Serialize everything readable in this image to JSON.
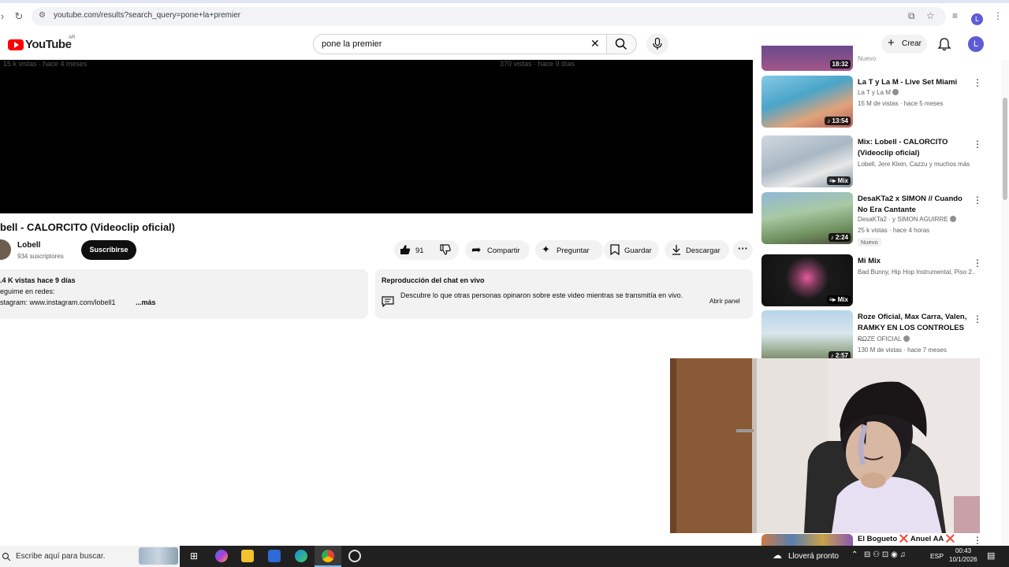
{
  "browser": {
    "url": "youtube.com/results?search_query=pone+la+premier"
  },
  "header": {
    "logo_text": "YouTube",
    "country_code": "AR",
    "search_value": "pone la premier",
    "create_label": "Crear",
    "avatar_letter": "L"
  },
  "player": {
    "ghost_left": "15 k vistas · hace 4 meses",
    "ghost_right": "370 vistas · hace 9 días"
  },
  "video": {
    "title": "bell - CALORCITO (Videoclip oficial)",
    "channel": "Lobell",
    "subscribers": "934 suscriptores",
    "subscribe_label": "Suscribirse",
    "likes": "91",
    "share_label": "Compartir",
    "ask_label": "Preguntar",
    "save_label": "Guardar",
    "download_label": "Descargar"
  },
  "description": {
    "stats": ".4 K vistas  hace 9 días",
    "line2": "eguime en redes:",
    "line3": "stagram: www.instagram.com/lobell1",
    "more": "...más"
  },
  "chat": {
    "title": "Reproducción del chat en vivo",
    "body": "Descubre lo que otras personas opinaron sobre este video mientras se transmitía en vivo.",
    "open_label": "Abrir panel"
  },
  "sidebar": {
    "partial_top": {
      "duration": "18:32",
      "tag": "Nuevo"
    },
    "items": [
      {
        "title": "La T y La M - Live Set Miami",
        "channel": "La T y La M",
        "meta": "15 M de vistas · hace 5 meses",
        "badge": "13:54",
        "new": ""
      },
      {
        "title": "Mix: Lobell - CALORCITO (Videoclip oficial)",
        "channel": "Lobell, Jere Klein, Cazzu y muchos más",
        "meta": "",
        "badge": "Mix",
        "new": ""
      },
      {
        "title": "DesaKTa2 x SIMON // Cuando No Era Cantante",
        "channel": "DesaKTa2 · y SIMON AGUIRRE",
        "meta": "25 k vistas · hace 4 horas",
        "badge": "2:24",
        "new": "Nuevo"
      },
      {
        "title": "Mi Mix",
        "channel": "Bad Bunny, Hip Hop Instrumental, Piso 2...",
        "meta": "",
        "badge": "Mix",
        "new": ""
      },
      {
        "title": "Roze Oficial, Max Carra, Valen, RAMKY EN LOS CONTROLES -...",
        "channel": "ROZE OFICIAL",
        "meta": "130 M de vistas · hace 7 meses",
        "badge": "2:57",
        "new": ""
      }
    ],
    "partial_bottom_title": "El Bogueto ❌ Anuel AA ❌"
  },
  "taskbar": {
    "search_placeholder": "Escribe aquí para buscar.",
    "weather": "Lloverá pronto",
    "lang": "ESP",
    "time": "00:43",
    "date": "10/1/2026"
  },
  "colors": {
    "youtube_red": "#ff0000",
    "avatar": "#5f5bd6",
    "pill_bg": "#f2f2f2"
  }
}
